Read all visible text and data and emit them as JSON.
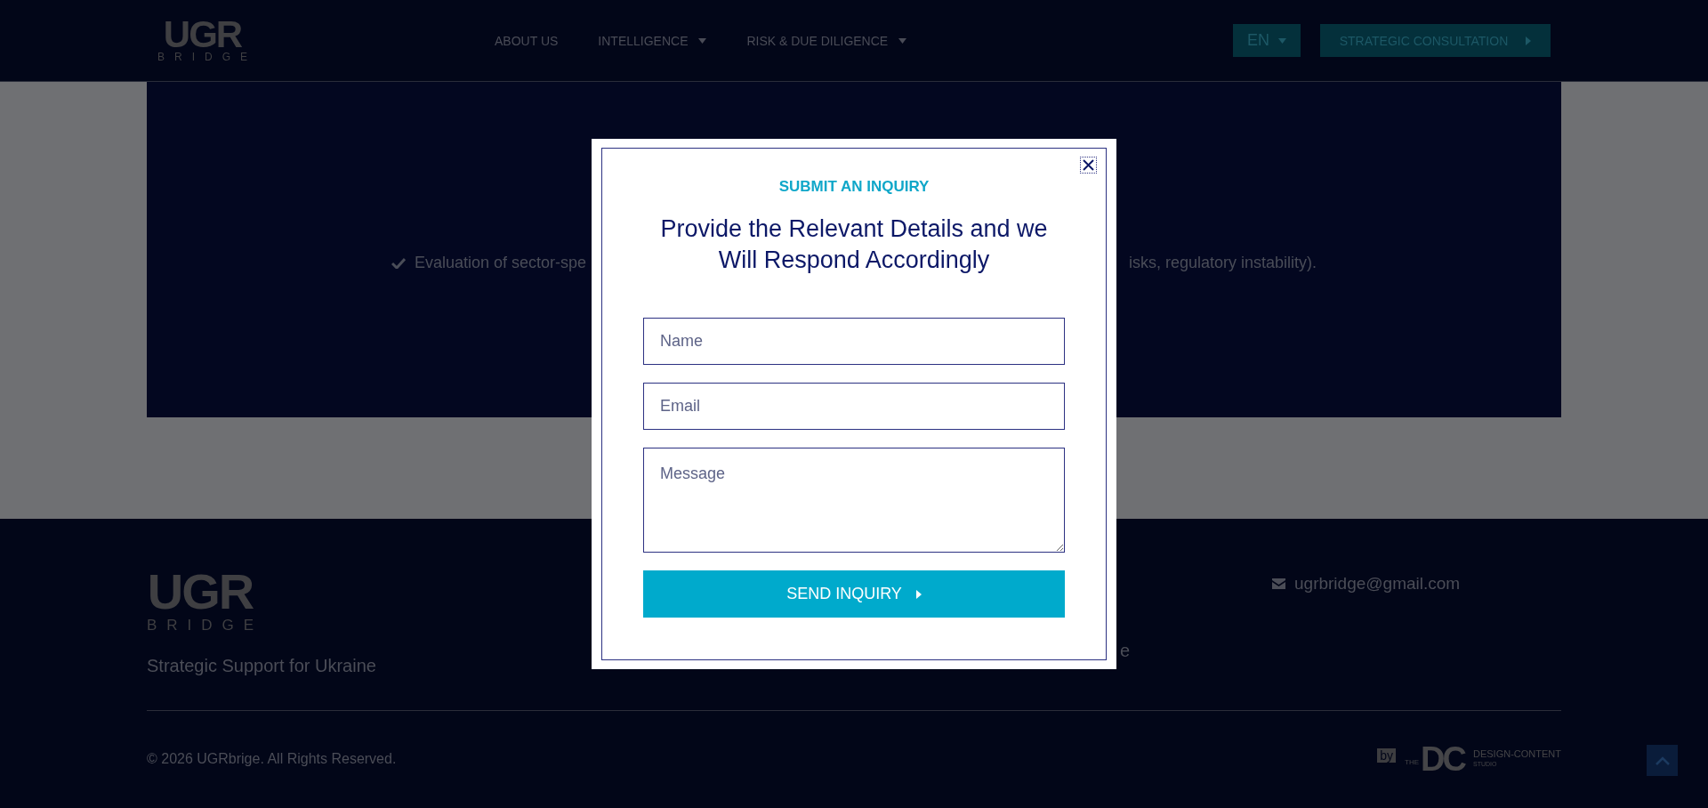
{
  "header": {
    "logo": {
      "wordmark": "UGR",
      "subtitle": "BRIDGE"
    },
    "nav": [
      {
        "label": "ABOUT US",
        "dropdown": false
      },
      {
        "label": "INTELLIGENCE",
        "dropdown": true
      },
      {
        "label": "RISK & DUE DILIGENCE",
        "dropdown": true
      }
    ],
    "language": {
      "label": "EN"
    },
    "cta": {
      "label": "STRATEGIC CONSULTATION"
    }
  },
  "section": {
    "feature": {
      "text_before": "Evaluation of sector-spe",
      "text_after": "isks, regulatory instability)."
    }
  },
  "modal": {
    "eyebrow": "SUBMIT AN INQUIRY",
    "heading": "Provide the Relevant Details and we Will Respond Accordingly",
    "fields": [
      {
        "kind": "input",
        "placeholder": "Name"
      },
      {
        "kind": "input",
        "placeholder": "Email"
      },
      {
        "kind": "textarea",
        "placeholder": "Message"
      }
    ],
    "submit": "SEND INQUIRY"
  },
  "footer": {
    "logo": {
      "wordmark": "UGR",
      "subtitle": "BRIDGE"
    },
    "tagline": "Strategic Support for Ukraine",
    "column_2": "e",
    "email": "ugrbridge@gmail.com",
    "copyright": "© 2026 UGRbrige. All Rights Reserved.",
    "credit": {
      "by": "by",
      "the": "THE",
      "mark": "DC",
      "name": "DESIGN-CONTENT",
      "sub": "STUDIO"
    }
  }
}
